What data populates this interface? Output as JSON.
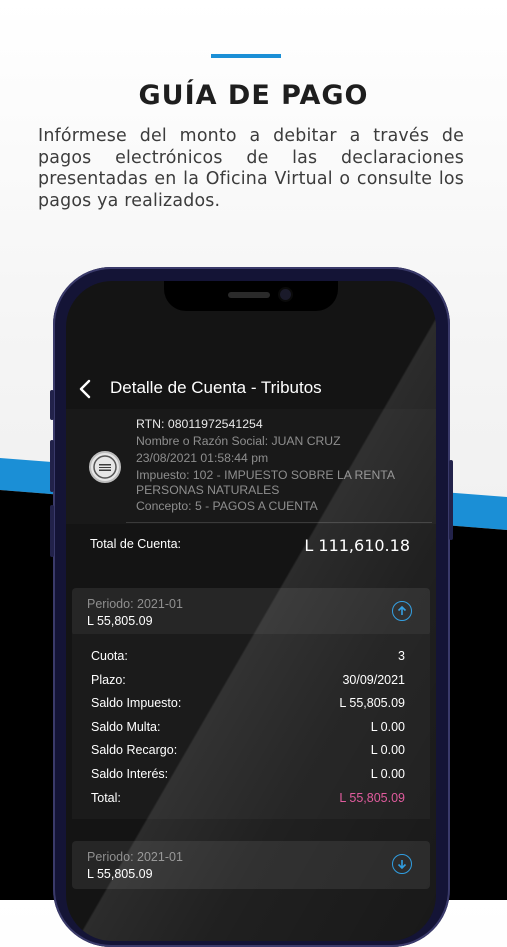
{
  "promo": {
    "headline": "GUÍA DE PAGO",
    "subtitle": "Infórmese del monto a debitar a través de pagos electrónicos de las declaraciones presentadas en la Oficina Virtual o consulte los pagos ya realizados.",
    "accent_color": "#1b8fd6"
  },
  "app": {
    "header": {
      "back_icon": "chevron-left-icon",
      "title": "Detalle de Cuenta - Tributos"
    },
    "account": {
      "logo_icon": "institution-seal-icon",
      "rtn": "RTN: 08011972541254",
      "name": "Nombre o Razón Social: JUAN CRUZ",
      "datetime": "23/08/2021 01:58:44 pm",
      "impuesto_line1": "Impuesto: 102 - IMPUESTO SOBRE LA RENTA",
      "impuesto_line2": "PERSONAS NATURALES",
      "concepto": "Concepto: 5 - PAGOS A CUENTA"
    },
    "total": {
      "label": "Total de Cuenta:",
      "amount": "L 111,610.18"
    },
    "periods": [
      {
        "label": "Periodo: 2021-01",
        "amount": "L 55,805.09",
        "toggle_icon": "arrow-up-circle-icon",
        "expanded": true,
        "details": [
          {
            "label": "Cuota:",
            "value": "3"
          },
          {
            "label": "Plazo:",
            "value": "30/09/2021"
          },
          {
            "label": "Saldo Impuesto:",
            "value": "L 55,805.09"
          },
          {
            "label": "Saldo Multa:",
            "value": "L 0.00"
          },
          {
            "label": "Saldo Recargo:",
            "value": "L 0.00"
          },
          {
            "label": "Saldo Interés:",
            "value": "L 0.00"
          },
          {
            "label": "Total:",
            "value": "L 55,805.09"
          }
        ]
      },
      {
        "label": "Periodo: 2021-01",
        "amount": "L 55,805.09",
        "toggle_icon": "arrow-down-circle-icon",
        "expanded": false
      }
    ],
    "colors": {
      "total_highlight": "#e0559a",
      "toggle_blue": "#2a9be0"
    }
  }
}
